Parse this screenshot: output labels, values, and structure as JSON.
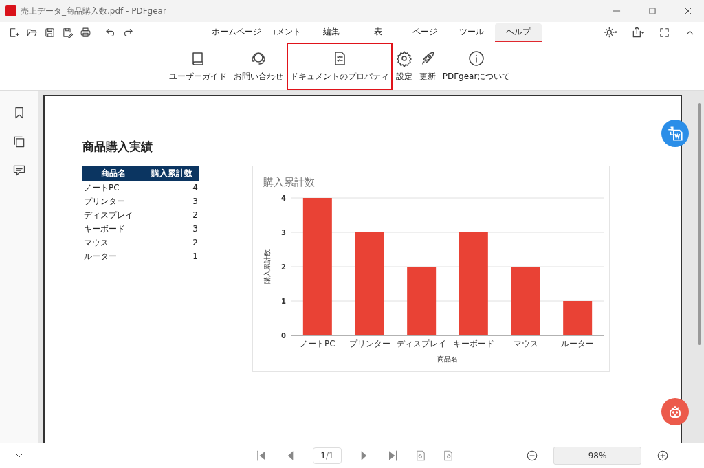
{
  "window": {
    "title": "売上データ_商品購入数.pdf - PDFgear"
  },
  "menu_tabs": [
    {
      "label": "ホームページ",
      "selected": false
    },
    {
      "label": "コメント",
      "selected": false
    },
    {
      "label": "編集",
      "selected": false
    },
    {
      "label": "表",
      "selected": false
    },
    {
      "label": "ページ",
      "selected": false
    },
    {
      "label": "ツール",
      "selected": false
    },
    {
      "label": "ヘルプ",
      "selected": true
    }
  ],
  "ribbon": [
    {
      "label": "ユーザーガイド",
      "highlighted": false
    },
    {
      "label": "お問い合わせ",
      "highlighted": false
    },
    {
      "label": "ドキュメントのプロパティ",
      "highlighted": true
    },
    {
      "label": "設定",
      "highlighted": false
    },
    {
      "label": "更新",
      "highlighted": false
    },
    {
      "label": "PDFgearについて",
      "highlighted": false
    }
  ],
  "document": {
    "title": "商品購入実績",
    "table": {
      "columns": [
        "商品名",
        "購入累計数"
      ],
      "rows": [
        [
          "ノートPC",
          "4"
        ],
        [
          "プリンター",
          "3"
        ],
        [
          "ディスプレイ",
          "2"
        ],
        [
          "キーボード",
          "3"
        ],
        [
          "マウス",
          "2"
        ],
        [
          "ルーター",
          "1"
        ]
      ]
    },
    "chart_data": {
      "type": "bar",
      "title": "購入累計数",
      "xlabel": "商品名",
      "ylabel": "購入累計数",
      "categories": [
        "ノートPC",
        "プリンター",
        "ディスプレイ",
        "キーボード",
        "マウス",
        "ルーター"
      ],
      "series": [
        {
          "color": "#e94235",
          "values": [
            4,
            3,
            2,
            3,
            2,
            1
          ]
        }
      ],
      "grid": true,
      "ylim": [
        0,
        4
      ],
      "yticks": [
        0,
        1,
        2,
        3,
        4
      ]
    }
  },
  "pager": {
    "page": "1",
    "total": "/1"
  },
  "zoom": "98%"
}
